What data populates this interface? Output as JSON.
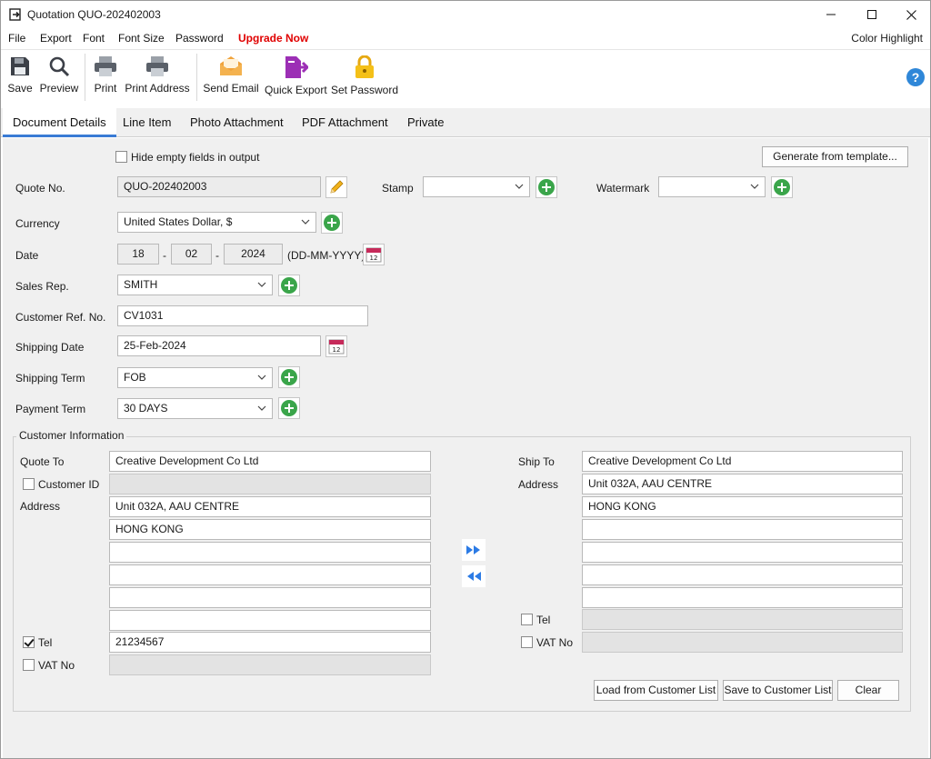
{
  "window": {
    "title": "Quotation QUO-202402003"
  },
  "menu": {
    "file": "File",
    "export": "Export",
    "font": "Font",
    "font_size": "Font Size",
    "password": "Password",
    "upgrade": "Upgrade Now",
    "color_highlight": "Color Highlight"
  },
  "toolbar": {
    "save": "Save",
    "preview": "Preview",
    "print": "Print",
    "print_address": "Print Address",
    "send_email": "Send Email",
    "quick_export": "Quick Export",
    "set_password": "Set Password"
  },
  "tabs": [
    "Document Details",
    "Line Item",
    "Photo Attachment",
    "PDF Attachment",
    "Private"
  ],
  "form": {
    "hide_empty": "Hide empty fields in output",
    "generate_template": "Generate from template...",
    "quote_no_label": "Quote No.",
    "quote_no": "QUO-202402003",
    "stamp_label": "Stamp",
    "stamp": "",
    "watermark_label": "Watermark",
    "watermark": "",
    "currency_label": "Currency",
    "currency": "United States Dollar, $",
    "date_label": "Date",
    "date_day": "18",
    "date_month": "02",
    "date_year": "2024",
    "date_sep": "-",
    "date_format": "(DD-MM-YYYY)",
    "sales_rep_label": "Sales Rep.",
    "sales_rep": "SMITH",
    "customer_ref_label": "Customer Ref. No.",
    "customer_ref": "CV1031",
    "shipping_date_label": "Shipping Date",
    "shipping_date": "25-Feb-2024",
    "shipping_term_label": "Shipping Term",
    "shipping_term": "FOB",
    "payment_term_label": "Payment Term",
    "payment_term": "30 DAYS"
  },
  "customer": {
    "group_title": "Customer Information",
    "quote_to_label": "Quote To",
    "quote_to": "Creative Development Co Ltd",
    "customer_id_label": "Customer ID",
    "customer_id": "",
    "address_label": "Address",
    "address": [
      "Unit 032A, AAU CENTRE",
      "HONG KONG",
      "",
      "",
      "",
      ""
    ],
    "tel_label": "Tel",
    "tel": "21234567",
    "tel_checked": true,
    "vat_label": "VAT No",
    "vat": "",
    "ship_to_label": "Ship To",
    "ship_to": "Creative Development Co Ltd",
    "ship_address_label": "Address",
    "ship_address": [
      "Unit 032A, AAU CENTRE",
      "HONG KONG",
      "",
      "",
      "",
      ""
    ],
    "ship_tel_label": "Tel",
    "ship_vat_label": "VAT No",
    "load_button": "Load from Customer List",
    "save_button": "Save to Customer List",
    "clear_button": "Clear"
  },
  "colors": {
    "accent": "#3a7bd5",
    "upgrade": "#e00000",
    "add": "#3aa54a"
  }
}
